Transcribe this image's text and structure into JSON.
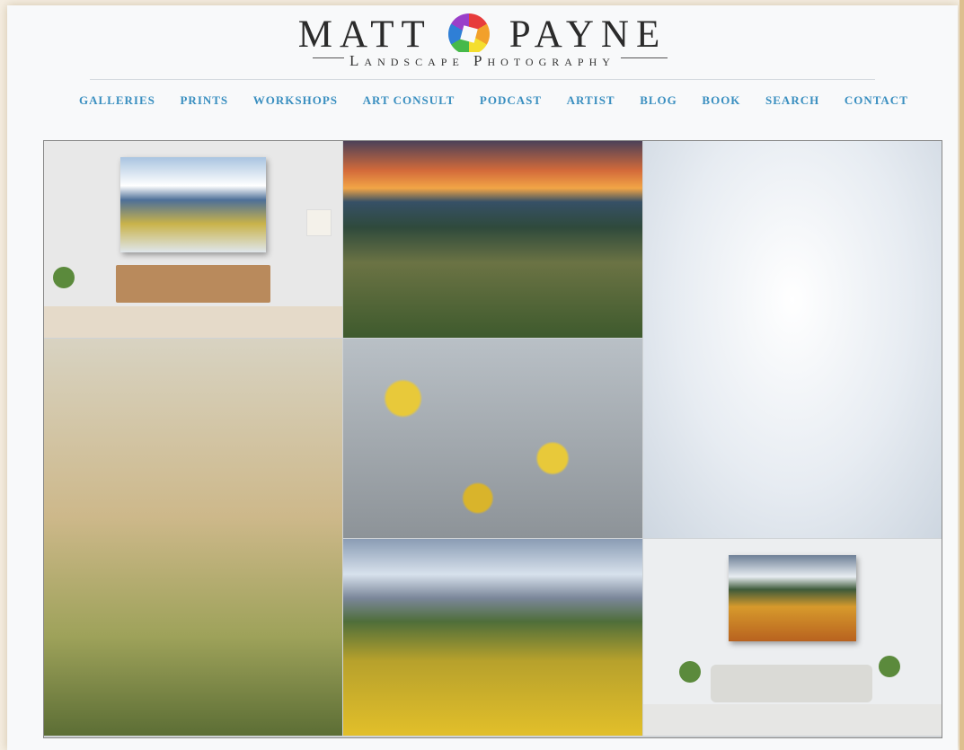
{
  "logo": {
    "word_left": "MATT",
    "word_right": "PAYNE",
    "subtitle": "Landscape Photography",
    "icon": "rainbow-aperture-icon"
  },
  "nav": {
    "items": [
      "GALLERIES",
      "PRINTS",
      "WORKSHOPS",
      "ART CONSULT",
      "PODCAST",
      "ARTIST",
      "BLOG",
      "BOOK",
      "SEARCH",
      "CONTACT"
    ],
    "color": "#3a8fc0"
  },
  "grid": {
    "tiles": [
      "interior-mockup-living-room",
      "sunset-valley-fog",
      "snowy-tree",
      "aspen-forest-fog",
      "aspen-leaves-closeup",
      "mountain-valley-autumn",
      "interior-mockup-sofa"
    ]
  }
}
